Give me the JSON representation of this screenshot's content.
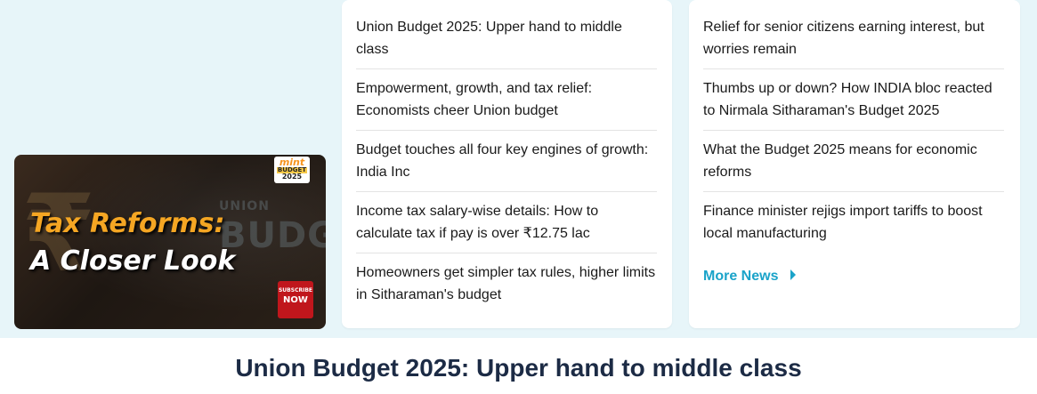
{
  "video": {
    "title_line1": "Tax Reforms:",
    "title_line2": "A Closer Look",
    "bg_small": "UNION",
    "bg_big": "BUDGET",
    "rupee_glyph": "₹",
    "logo": {
      "brand": "mint",
      "line2": "BUDGET",
      "line3": "2025"
    },
    "subscribe": {
      "line1": "SUBSCRIBE",
      "line2": "NOW"
    }
  },
  "left_column": {
    "items": [
      {
        "text": "Union Budget 2025: Upper hand to middle class"
      },
      {
        "text": "Empowerment, growth, and tax relief: Economists cheer Union budget"
      },
      {
        "text": "Budget touches all four key engines of growth: India Inc"
      },
      {
        "text": "Income tax salary-wise details: How to calculate tax if pay is over ₹12.75 lac"
      },
      {
        "text": "Homeowners get simpler tax rules, higher limits in Sitharaman's budget"
      }
    ]
  },
  "right_column": {
    "items": [
      {
        "text": "Relief for senior citizens earning interest, but worries remain"
      },
      {
        "text": "Thumbs up or down? How INDIA bloc reacted to Nirmala Sitharaman's Budget 2025"
      },
      {
        "text": "What the Budget 2025 means for economic reforms"
      },
      {
        "text": "Finance minister rejigs import tariffs to boost local manufacturing"
      }
    ],
    "more_label": "More News"
  },
  "headline": "Union Budget 2025: Upper hand to middle class",
  "colors": {
    "band_bg": "#e7f5f9",
    "link_accent": "#1aa3c9",
    "headline": "#1c2b45",
    "title_orange": "#f5a623",
    "subscribe_red": "#c0161c"
  }
}
